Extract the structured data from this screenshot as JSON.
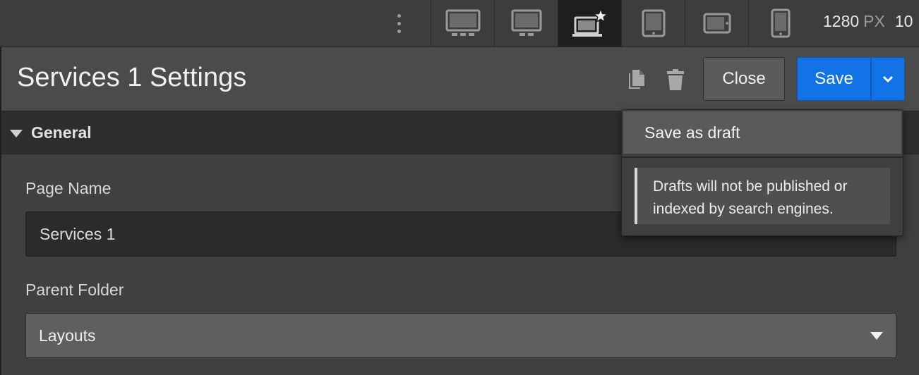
{
  "toolbar": {
    "devices": [
      {
        "name": "desktop-large",
        "icon": "monitor-large-icon"
      },
      {
        "name": "desktop",
        "icon": "monitor-icon"
      },
      {
        "name": "laptop-base",
        "icon": "laptop-star-icon",
        "active": true
      },
      {
        "name": "tablet",
        "icon": "tablet-icon"
      },
      {
        "name": "mobile-landscape",
        "icon": "phone-landscape-icon"
      },
      {
        "name": "mobile-portrait",
        "icon": "phone-portrait-icon"
      }
    ],
    "width_value": "1280",
    "width_unit": "PX",
    "zoom_value": "10"
  },
  "header": {
    "title": "Services 1 Settings",
    "duplicate_icon": "duplicate-icon",
    "delete_icon": "trash-icon",
    "close_label": "Close",
    "save_label": "Save"
  },
  "section": {
    "title": "General",
    "expanded": true
  },
  "fields": {
    "page_name_label": "Page Name",
    "page_name_value": "Services 1",
    "parent_folder_label": "Parent Folder",
    "parent_folder_value": "Layouts"
  },
  "save_menu": {
    "item_label": "Save as draft",
    "note": "Drafts will not be published or indexed by search engines."
  },
  "colors": {
    "accent": "#1173e5",
    "toolbar_bg": "#3d3d3d",
    "panel_bg": "#404040"
  }
}
